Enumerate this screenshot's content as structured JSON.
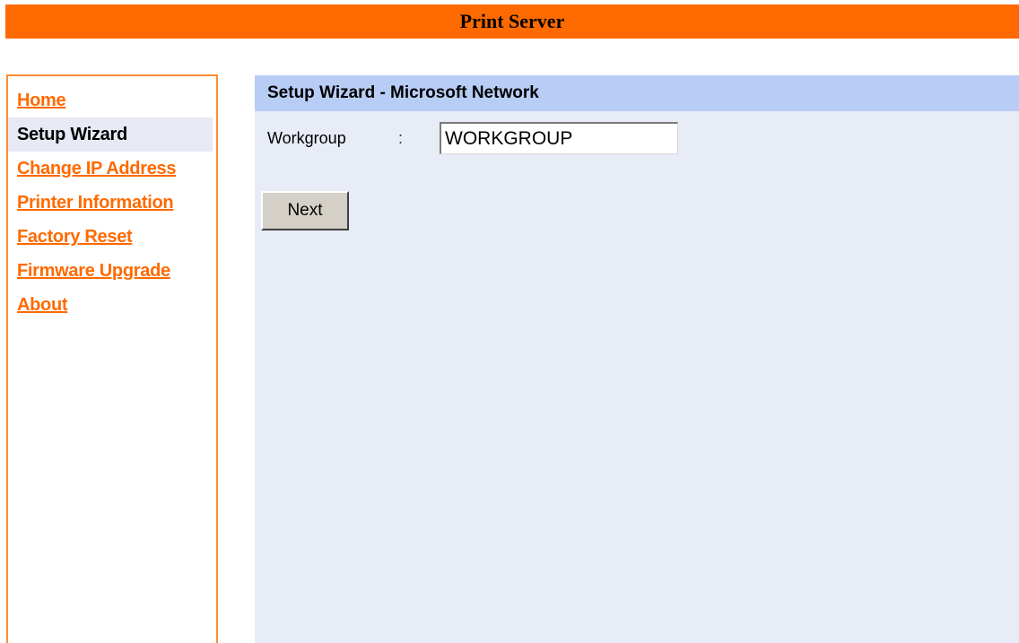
{
  "header": {
    "title": "Print Server"
  },
  "sidebar": {
    "items": [
      {
        "label": "Home",
        "active": false
      },
      {
        "label": "Setup Wizard",
        "active": true
      },
      {
        "label": "Change IP Address",
        "active": false
      },
      {
        "label": "Printer Information",
        "active": false
      },
      {
        "label": "Factory Reset",
        "active": false
      },
      {
        "label": "Firmware Upgrade",
        "active": false
      },
      {
        "label": "About",
        "active": false
      }
    ]
  },
  "main": {
    "section_title": "Setup Wizard - Microsoft Network",
    "workgroup": {
      "label": "Workgroup",
      "separator": ":",
      "value": "WORKGROUP"
    },
    "next_label": "Next"
  },
  "colors": {
    "header_bg": "#ff6a00",
    "link": "#ff6a00",
    "section_header_bg": "#b8cdf5",
    "content_bg": "#e8ecf6",
    "active_nav_bg": "#e7eaf5"
  }
}
